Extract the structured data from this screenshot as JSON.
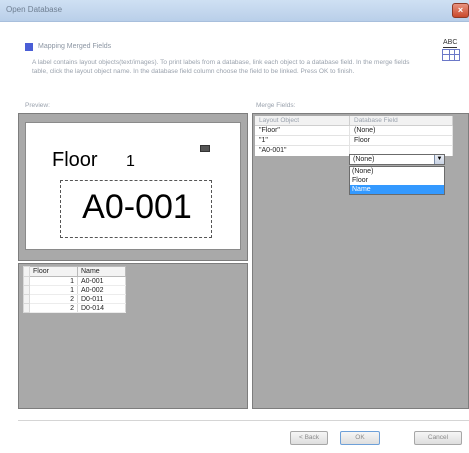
{
  "window": {
    "title": "Open Database",
    "close_glyph": "×"
  },
  "header": {
    "section_label": "Mapping Merged Fields",
    "description": "A label contains layout objects(text/images). To print labels from a database, link each object to a database field. In the merge fields table, click the layout object name. In the database field column choose the field to be linked. Press OK to finish.",
    "icon": "abc-grid-icon",
    "icon_text": "ABC"
  },
  "preview": {
    "label": "Preview:",
    "floor_text": "Floor",
    "floor_number": "1",
    "room_code": "A0-001"
  },
  "data_table": {
    "columns": [
      "Floor",
      "Name"
    ],
    "rows": [
      [
        "1",
        "A0-001"
      ],
      [
        "1",
        "A0-002"
      ],
      [
        "2",
        "D0-011"
      ],
      [
        "2",
        "D0-014"
      ]
    ]
  },
  "merge_fields": {
    "label": "Merge Fields:",
    "columns": [
      "Layout Object",
      "Database Field"
    ],
    "rows": [
      {
        "object": "\"Floor\"",
        "field": "(None)"
      },
      {
        "object": "\"1\"",
        "field": "Floor"
      },
      {
        "object": "\"A0-001\"",
        "field": "(None)"
      }
    ],
    "dropdown_options": [
      "(None)",
      "Floor",
      "Name"
    ],
    "dropdown_highlighted": "Name"
  },
  "buttons": {
    "back": "< Back",
    "ok": "OK",
    "cancel": "Cancel"
  },
  "colors": {
    "selection": "#3399ff",
    "section_marker": "#4a5ed6",
    "pane_bg": "#a9a9a9"
  }
}
